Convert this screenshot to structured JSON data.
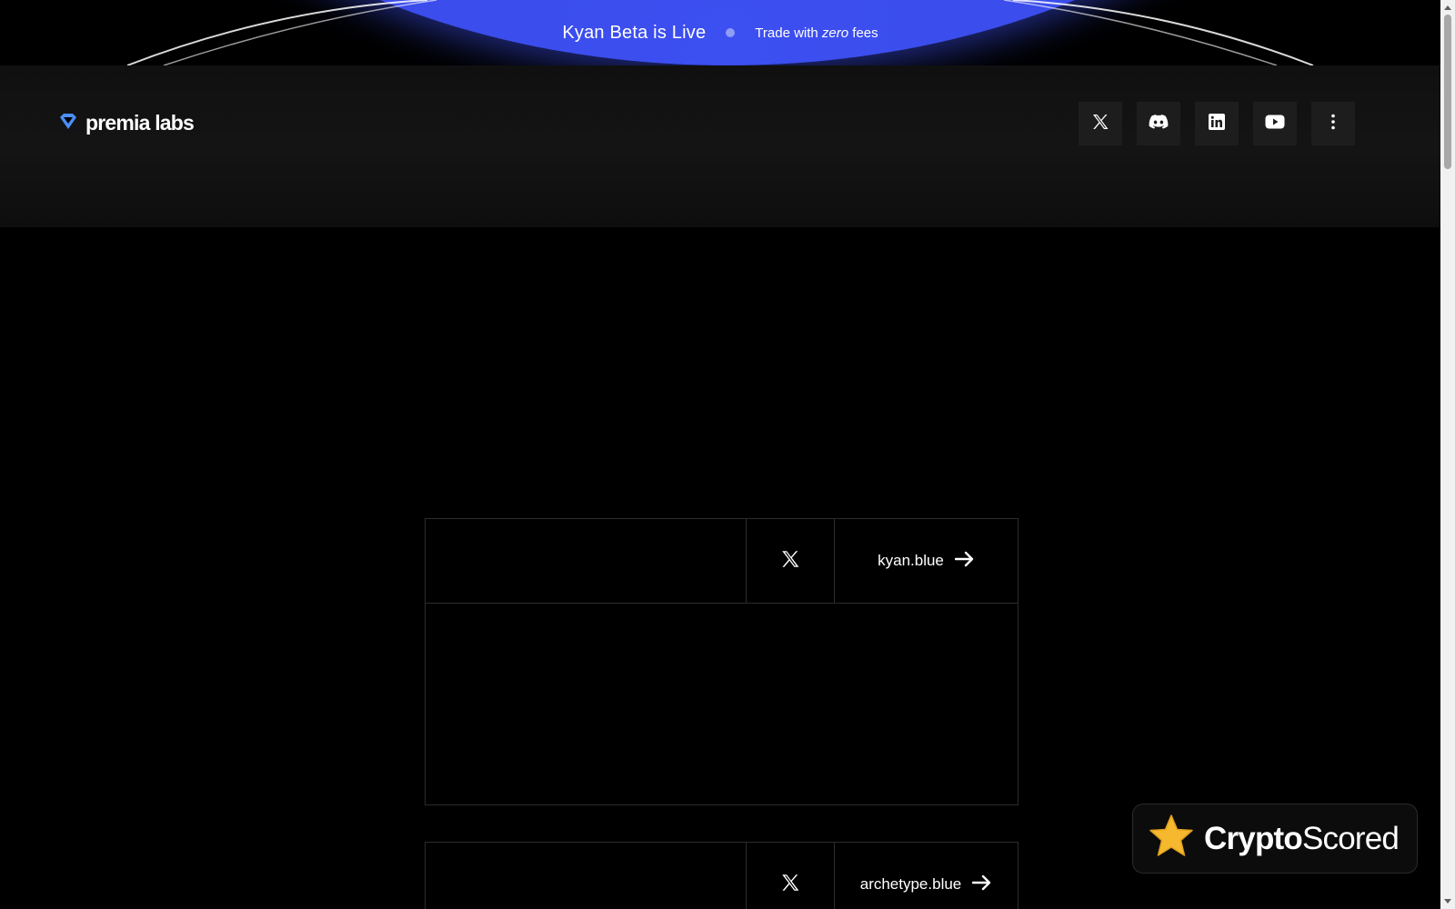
{
  "banner": {
    "title": "Kyan Beta is Live",
    "sub_prefix": "Trade with ",
    "sub_emphasis": "zero",
    "sub_suffix": " fees"
  },
  "header": {
    "logo_text": "premia labs",
    "socials": [
      "x-icon",
      "discord-icon",
      "linkedin-icon",
      "youtube-icon",
      "more-vertical-icon"
    ]
  },
  "cards": [
    {
      "link_label": "kyan.blue"
    },
    {
      "link_label": "archetype.blue"
    }
  ],
  "badge": {
    "bold": "Crypto",
    "regular": "Scored"
  },
  "colors": {
    "banner_blue": "#3c4ff0",
    "logo_blue": "#4a8ff7",
    "star_gold": "#f5b82e"
  }
}
